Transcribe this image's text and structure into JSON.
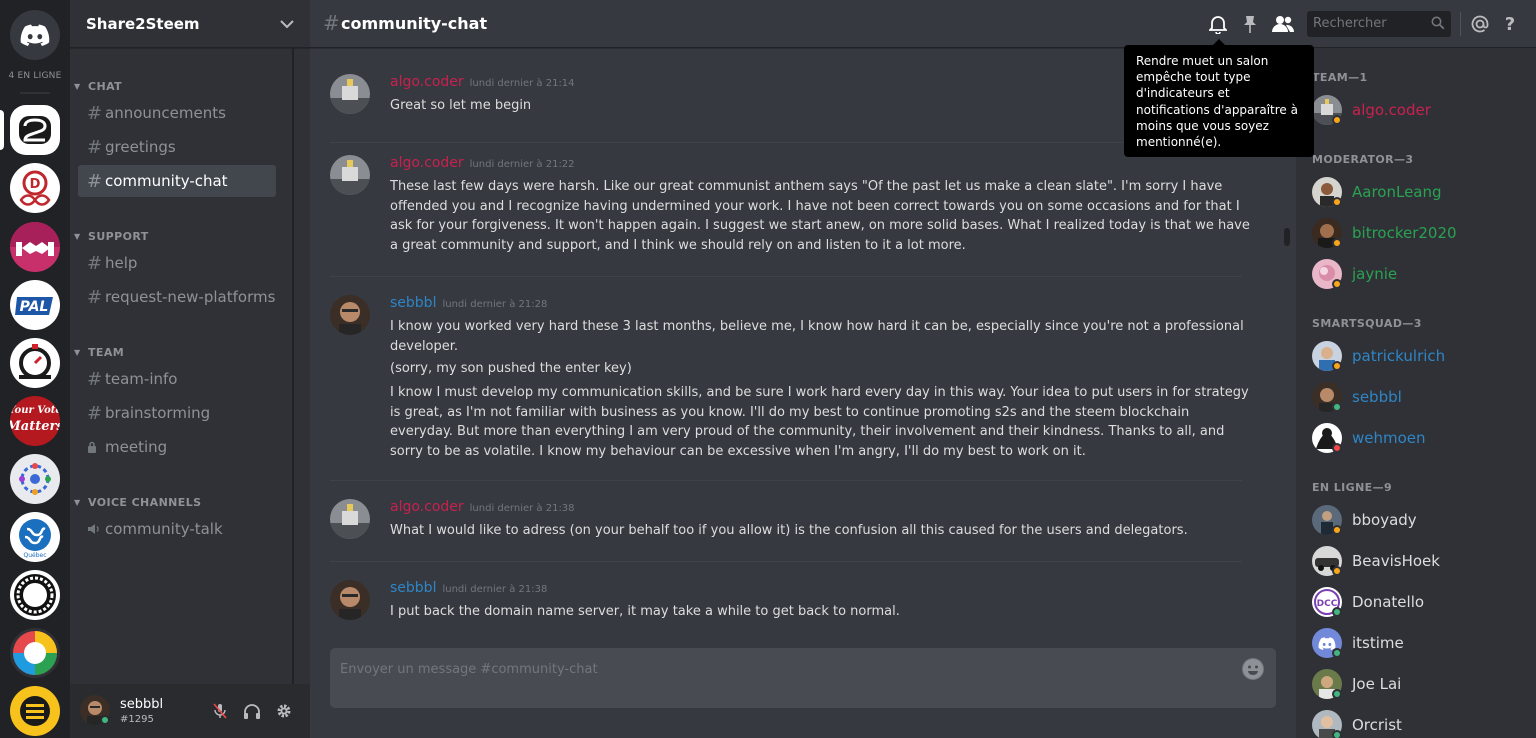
{
  "colors": {
    "team": "#c9214f",
    "moderator": "#2aa252",
    "smartsquad": "#2f85c6",
    "online": "#43b581",
    "idle": "#faa61a",
    "dnd": "#f04747"
  },
  "rail": {
    "home_icon": "discord-icon",
    "online_label": "4 EN LIGNE",
    "servers": [
      {
        "id": "share2steem",
        "icon": "share2steem-logo"
      },
      {
        "id": "dlive",
        "icon": "dlive-logo"
      },
      {
        "id": "handshake",
        "icon": "handshake-logo"
      },
      {
        "id": "pal",
        "icon": "pal-logo",
        "text": "PAL"
      },
      {
        "id": "stopwatch",
        "icon": "stopwatch-logo"
      },
      {
        "id": "your-vote-matters",
        "icon": "your-vote-matters-logo",
        "text": "Your Vote Matters"
      },
      {
        "id": "community-circle",
        "icon": "people-circle-logo"
      },
      {
        "id": "steem-quebec",
        "icon": "steem-logo"
      },
      {
        "id": "ouroboros",
        "icon": "ouroboros-logo"
      },
      {
        "id": "color-ring",
        "icon": "color-ring-logo"
      },
      {
        "id": "yellow-book",
        "icon": "book-logo"
      }
    ]
  },
  "sidebar": {
    "guild_name": "Share2Steem",
    "categories": {
      "chat": "CHAT",
      "support": "SUPPORT",
      "team": "TEAM",
      "voice": "VOICE CHANNELS"
    },
    "channels": {
      "announcements": "announcements",
      "greetings": "greetings",
      "community_chat": "community-chat",
      "help": "help",
      "request_new_platforms": "request-new-platforms",
      "team_info": "team-info",
      "brainstorming": "brainstorming",
      "meeting": "meeting",
      "community_talk": "community-talk"
    },
    "user": {
      "name": "sebbbl",
      "tag": "#1295"
    }
  },
  "header": {
    "channel_name": "community-chat",
    "search_placeholder": "Rechercher",
    "tooltip": "Rendre muet un salon empêche tout type d'indicateurs et notifications d'apparaître à moins que vous soyez mentionné(e)."
  },
  "messages": [
    {
      "author": "algo.coder",
      "role": "team",
      "time": "lundi dernier à 21:14",
      "lines": [
        "Great so let me begin"
      ]
    },
    {
      "author": "algo.coder",
      "role": "team",
      "time": "lundi dernier à 21:22",
      "lines": [
        "These last few days were harsh. Like our great communist anthem says \"Of the past let us make a clean slate\". I'm sorry I have offended you and I recognize having undermined your work. I have not been correct towards you on some occasions and for that I ask for your forgiveness. It won't happen again. I suggest we start anew, on more solid bases. What I realized today is that we have a great community and support, and I think we should rely on and listen to it a lot more."
      ]
    },
    {
      "author": "sebbbl",
      "role": "smartsquad",
      "time": "lundi dernier à 21:28",
      "lines": [
        "I know you worked very hard these 3 last months, believe me, I know how hard it can be, especially since you're not a professional developer.",
        "(sorry, my son pushed the enter key)",
        "I know I must develop my communication skills, and be sure I work hard every day in this way. Your idea to put users in for strategy is great, as I'm not familiar with business as you know. I'll do my best to continue promoting s2s and the steem blockchain everyday. But more than everything I am very proud of the community, their involvement and their kindness. Thanks to all, and sorry to be as volatile. I know my behaviour can be excessive when I'm angry, I'll do my best to work on it."
      ]
    },
    {
      "author": "algo.coder",
      "role": "team",
      "time": "lundi dernier à 21:38",
      "lines": [
        "What I would like to adress (on your behalf too if you allow it) is the confusion all this caused for the users and delegators."
      ]
    },
    {
      "author": "sebbbl",
      "role": "smartsquad",
      "time": "lundi dernier à 21:38",
      "lines": [
        "I put back the domain name server, it may take a while to get back to normal."
      ]
    }
  ],
  "composer": {
    "placeholder": "Envoyer un message #community-chat"
  },
  "members": {
    "groups": {
      "team": "TEAM—1",
      "moderator": "MODERATOR—3",
      "smartsquad": "SMARTSQUAD—3",
      "online": "EN LIGNE—9"
    },
    "team": [
      {
        "name": "algo.coder",
        "status": "idle"
      }
    ],
    "moderator": [
      {
        "name": "AaronLeang",
        "status": "idle"
      },
      {
        "name": "bitrocker2020",
        "status": "idle"
      },
      {
        "name": "jaynie",
        "status": "idle"
      }
    ],
    "smartsquad": [
      {
        "name": "patrickulrich",
        "status": "idle"
      },
      {
        "name": "sebbbl",
        "status": "online"
      },
      {
        "name": "wehmoen",
        "status": "dnd"
      }
    ],
    "online": [
      {
        "name": "bboyady",
        "status": "idle"
      },
      {
        "name": "BeavisHoek",
        "status": "idle"
      },
      {
        "name": "Donatello",
        "status": "online"
      },
      {
        "name": "itstime",
        "status": "online"
      },
      {
        "name": "Joe Lai",
        "status": "online"
      },
      {
        "name": "Orcrist",
        "status": "online"
      }
    ]
  }
}
